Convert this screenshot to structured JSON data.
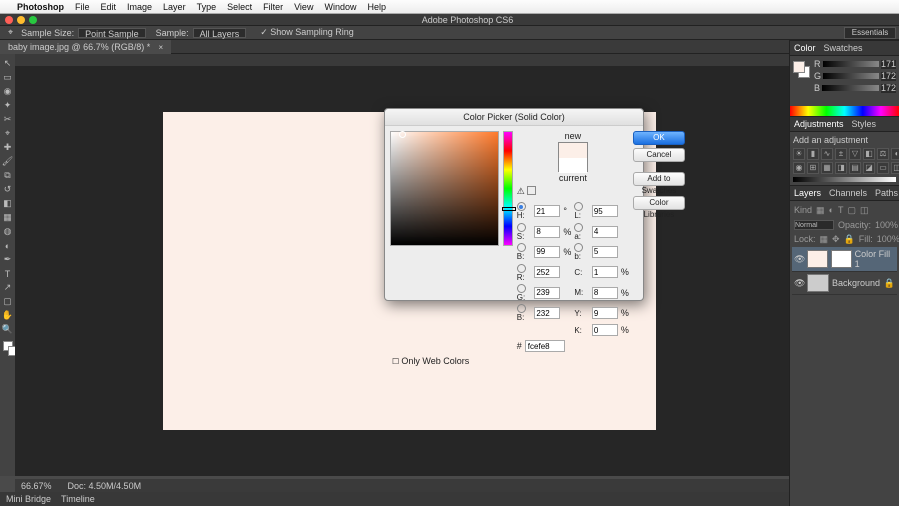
{
  "menubar": {
    "items": [
      "Photoshop",
      "File",
      "Edit",
      "Image",
      "Layer",
      "Type",
      "Select",
      "Filter",
      "View",
      "Window",
      "Help"
    ]
  },
  "window_title": "Adobe Photoshop CS6",
  "optbar": {
    "sample_size_label": "Sample Size:",
    "sample_size_value": "Point Sample",
    "sample_label": "Sample:",
    "sample_value": "All Layers",
    "show_ring": "Show Sampling Ring"
  },
  "tab": {
    "label": "baby image.jpg @ 66.7% (RGB/8) *",
    "close": "×"
  },
  "essentials": "Essentials",
  "status": {
    "zoom": "66.67%",
    "doc": "Doc: 4.50M/4.50M"
  },
  "bridge": {
    "mini": "Mini Bridge",
    "timeline": "Timeline"
  },
  "panels": {
    "color": {
      "tabs": [
        "Color",
        "Swatches"
      ],
      "r": "171",
      "g": "172",
      "b": "172"
    },
    "adjustments": {
      "tabs": [
        "Adjustments",
        "Styles"
      ],
      "addlabel": "Add an adjustment"
    },
    "layers": {
      "tabs": [
        "Layers",
        "Channels",
        "Paths"
      ],
      "kind": "Kind",
      "blend": "Normal",
      "opacity_label": "Opacity:",
      "opacity": "100%",
      "lock_label": "Lock:",
      "fill_label": "Fill:",
      "fill": "100%",
      "items": [
        {
          "name": "Color Fill 1"
        },
        {
          "name": "Background"
        }
      ]
    }
  },
  "colorpicker": {
    "title": "Color Picker (Solid Color)",
    "new_label": "new",
    "current_label": "current",
    "ok": "OK",
    "cancel": "Cancel",
    "add_swatches": "Add to Swatches",
    "color_libraries": "Color Libraries",
    "only_web": "Only Web Colors",
    "h": "21",
    "s": "8",
    "b": "99",
    "r": "252",
    "g": "239",
    "bval": "232",
    "l": "95",
    "a": "4",
    "bb": "5",
    "c": "1",
    "m": "8",
    "y": "9",
    "k": "0",
    "hex": "fcefe8",
    "h_unit": "°",
    "pct": "%"
  }
}
